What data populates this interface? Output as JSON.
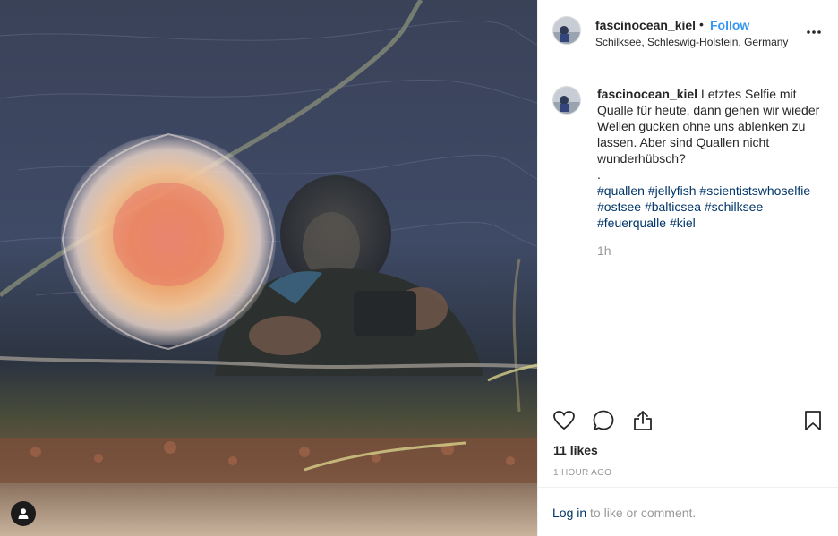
{
  "post": {
    "username": "fascinocean_kiel",
    "separator": "•",
    "follow_label": "Follow",
    "location": "Schilksee, Schleswig-Holstein, Germany",
    "more_icon": "more-options-icon"
  },
  "caption": {
    "username": "fascinocean_kiel",
    "text": "Letztes Selfie mit Qualle für heute, dann gehen wir wieder Wellen gucken ohne uns ablenken zu lassen. Aber sind Quallen nicht wunderhübsch?",
    "dot": ".",
    "hashtags": [
      "#quallen",
      "#jellyfish",
      "#scientistswhoselfie",
      "#ostsee",
      "#balticsea",
      "#schilksee",
      "#feuerqualle",
      "#kiel"
    ],
    "time": "1h"
  },
  "actions": {
    "like_icon": "heart-icon",
    "comment_icon": "comment-icon",
    "share_icon": "share-icon",
    "save_icon": "bookmark-icon",
    "likes": "11 likes",
    "date": "1 HOUR AGO"
  },
  "login": {
    "link_label": "Log in",
    "rest": " to like or comment."
  },
  "colors": {
    "accent": "#3897f0",
    "hashtag": "#003569",
    "muted": "#999999",
    "border": "#efefef"
  }
}
